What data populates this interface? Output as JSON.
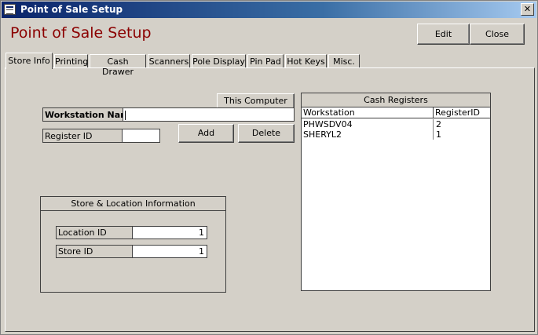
{
  "window": {
    "title": "Point of Sale Setup",
    "heading": "Point of Sale Setup",
    "close_glyph": "✕"
  },
  "toolbar": {
    "edit_label": "Edit",
    "close_label": "Close"
  },
  "tabs": [
    {
      "label": "Store Info",
      "active": true
    },
    {
      "label": "Printing"
    },
    {
      "label": "Cash Drawer"
    },
    {
      "label": "Scanners"
    },
    {
      "label": "Pole Display"
    },
    {
      "label": "Pin Pad"
    },
    {
      "label": "Hot Keys"
    },
    {
      "label": "Misc."
    }
  ],
  "store_info": {
    "this_computer_label": "This Computer",
    "workstation_name_label": "Workstation Name",
    "workstation_name_value": "",
    "register_id_label": "Register ID",
    "register_id_value": "",
    "add_label": "Add",
    "delete_label": "Delete",
    "location_group_title": "Store & Location Information",
    "location_id_label": "Location ID",
    "location_id_value": "1",
    "store_id_label": "Store ID",
    "store_id_value": "1"
  },
  "cash_registers": {
    "title": "Cash Registers",
    "columns": [
      "Workstation",
      "RegisterID"
    ],
    "rows": [
      [
        "PHWSDV04",
        "2"
      ],
      [
        "SHERYL2",
        "1"
      ]
    ]
  },
  "colors": {
    "heading": "#8b0000",
    "titlebar_start": "#0a246a",
    "face": "#d4d0c8"
  }
}
